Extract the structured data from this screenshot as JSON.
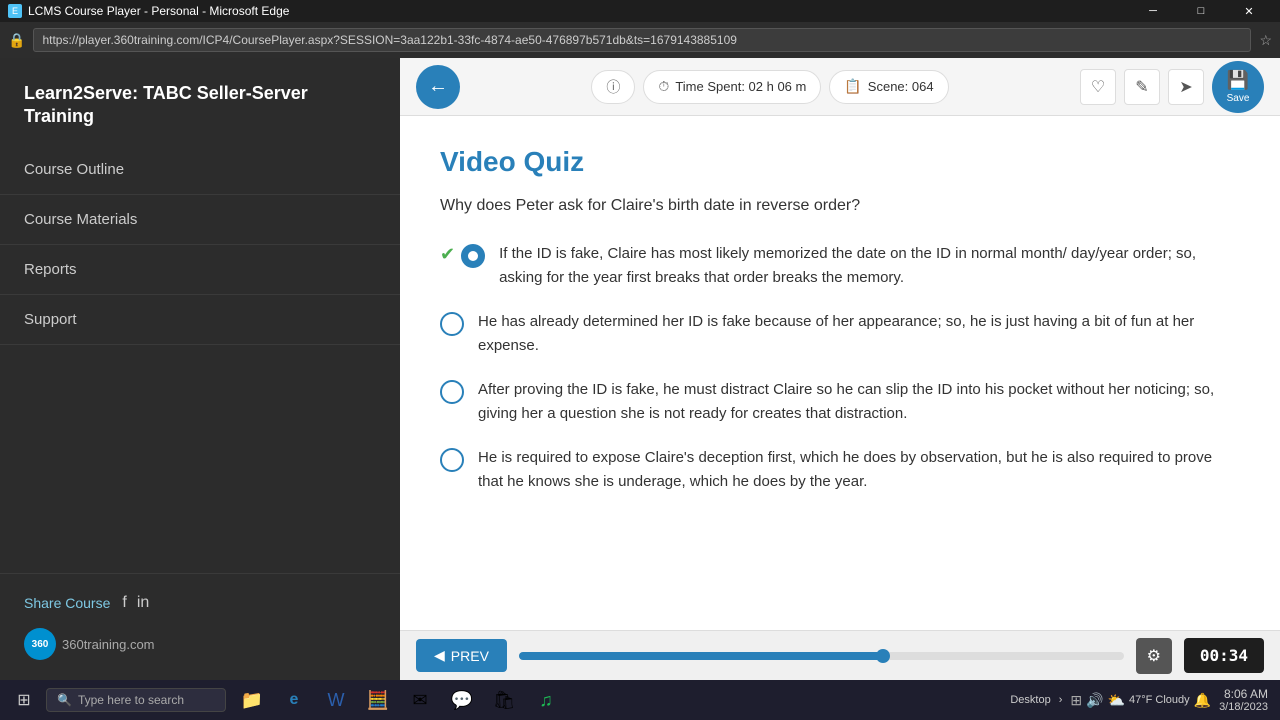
{
  "titlebar": {
    "title": "LCMS Course Player - Personal - Microsoft Edge",
    "controls": {
      "minimize": "─",
      "maximize": "□",
      "close": "✕"
    }
  },
  "addressbar": {
    "url": "https://player.360training.com/ICP4/CoursePlayer.aspx?SESSION=3aa122b1-33fc-4874-ae50-476897b571db&ts=1679143885109"
  },
  "sidebar": {
    "title": "Learn2Serve: TABC Seller-Server Training",
    "nav": [
      {
        "label": "Course Outline"
      },
      {
        "label": "Course Materials"
      },
      {
        "label": "Reports"
      },
      {
        "label": "Support"
      }
    ],
    "share_label": "Share Course",
    "social": {
      "facebook": "f",
      "linkedin": "in"
    },
    "logo_text": "360training.com"
  },
  "toolbar": {
    "time_label": "Time Spent: 02 h 06 m",
    "scene_label": "Scene: 064",
    "save_label": "Save"
  },
  "quiz": {
    "title": "Video Quiz",
    "question": "Why does Peter ask for Claire's birth date in reverse order?",
    "answers": [
      {
        "id": 1,
        "text": "If the ID is fake, Claire has most likely memorized the date on the ID in normal month/ day/year order; so, asking for the year first breaks that order breaks the memory.",
        "selected": true,
        "correct": true
      },
      {
        "id": 2,
        "text": "He has already determined her ID is fake because of her appearance; so, he is just having a bit of fun at her expense.",
        "selected": false,
        "correct": false
      },
      {
        "id": 3,
        "text": "After proving the ID is fake, he must distract Claire so he can slip the ID into his pocket without her noticing; so, giving her a question she is not ready for creates that distraction.",
        "selected": false,
        "correct": false
      },
      {
        "id": 4,
        "text": "He is required to expose Claire's deception first, which he does by observation, but he is also required to prove that he knows she is underage, which he does by the year.",
        "selected": false,
        "correct": false
      }
    ]
  },
  "bottombar": {
    "prev_label": "PREV",
    "progress_percent": 60,
    "timer": "00:34"
  },
  "taskbar": {
    "search_placeholder": "Type here to search",
    "time": "8:06 AM",
    "date": "3/18/2023",
    "weather": "47°F Cloudy",
    "desktop_label": "Desktop"
  }
}
